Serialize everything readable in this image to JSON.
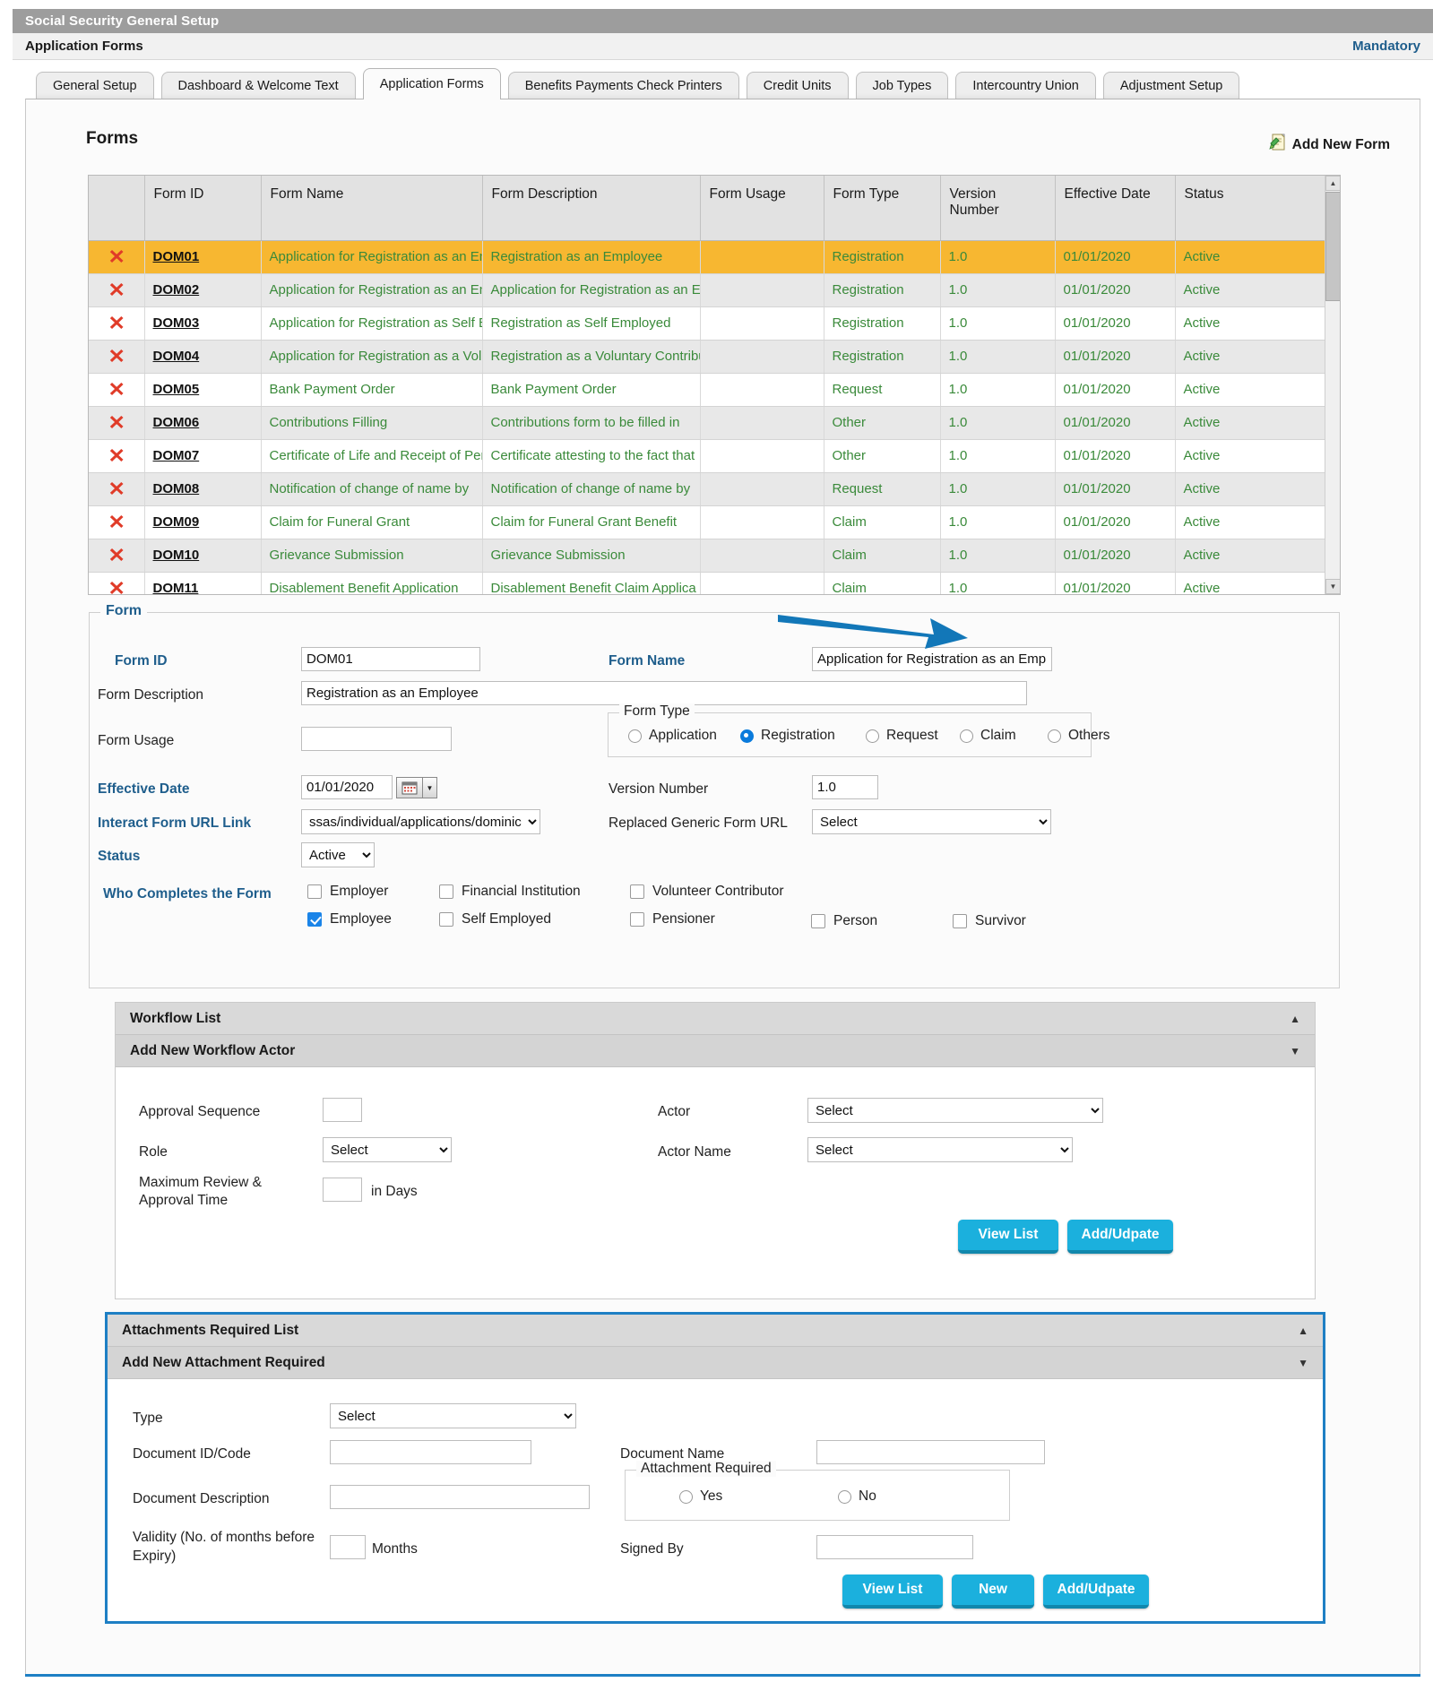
{
  "window": {
    "app_title": "Social Security General Setup",
    "page_title": "Application Forms",
    "mandatory_label": "Mandatory"
  },
  "tabs": [
    {
      "label": "General Setup",
      "active": false
    },
    {
      "label": "Dashboard & Welcome Text",
      "active": false
    },
    {
      "label": "Application Forms",
      "active": true
    },
    {
      "label": "Benefits Payments Check Printers",
      "active": false
    },
    {
      "label": "Credit Units",
      "active": false
    },
    {
      "label": "Job Types",
      "active": false
    },
    {
      "label": "Intercountry Union",
      "active": false
    },
    {
      "label": "Adjustment Setup",
      "active": false
    }
  ],
  "forms_section": {
    "heading": "Forms",
    "add_new_form_label": "Add New Form",
    "columns": [
      "",
      "Form ID",
      "Form Name",
      "Form Description",
      "Form Usage",
      "Form Type",
      "Version Number",
      "Effective Date",
      "Status"
    ],
    "rows": [
      {
        "id": "DOM01",
        "name": "Application for Registration as an Employee",
        "description": "Registration as an Employee",
        "usage": "",
        "type": "Registration",
        "version": "1.0",
        "effective_date": "01/01/2020",
        "status": "Active",
        "selected": true
      },
      {
        "id": "DOM02",
        "name": "Application for Registration as an Employer",
        "description": "Application for Registration as an Employer",
        "usage": "",
        "type": "Registration",
        "version": "1.0",
        "effective_date": "01/01/2020",
        "status": "Active",
        "selected": false
      },
      {
        "id": "DOM03",
        "name": "Application for Registration as Self Employed",
        "description": "Registration as Self Employed",
        "usage": "",
        "type": "Registration",
        "version": "1.0",
        "effective_date": "01/01/2020",
        "status": "Active",
        "selected": false
      },
      {
        "id": "DOM04",
        "name": "Application for Registration as a Voluntary Contributor",
        "description": "Registration as a Voluntary Contributor",
        "usage": "",
        "type": "Registration",
        "version": "1.0",
        "effective_date": "01/01/2020",
        "status": "Active",
        "selected": false
      },
      {
        "id": "DOM05",
        "name": "Bank Payment Order",
        "description": "Bank Payment Order",
        "usage": "",
        "type": "Request",
        "version": "1.0",
        "effective_date": "01/01/2020",
        "status": "Active",
        "selected": false
      },
      {
        "id": "DOM06",
        "name": "Contributions Filling",
        "description": "Contributions form to be filled in",
        "usage": "",
        "type": "Other",
        "version": "1.0",
        "effective_date": "01/01/2020",
        "status": "Active",
        "selected": false
      },
      {
        "id": "DOM07",
        "name": "Certificate of Life and Receipt of Pension",
        "description": "Certificate attesting to the fact that",
        "usage": "",
        "type": "Other",
        "version": "1.0",
        "effective_date": "01/01/2020",
        "status": "Active",
        "selected": false
      },
      {
        "id": "DOM08",
        "name": "Notification of change of name by",
        "description": "Notification of change of name by",
        "usage": "",
        "type": "Request",
        "version": "1.0",
        "effective_date": "01/01/2020",
        "status": "Active",
        "selected": false
      },
      {
        "id": "DOM09",
        "name": "Claim for Funeral Grant",
        "description": "Claim for Funeral Grant Benefit",
        "usage": "",
        "type": "Claim",
        "version": "1.0",
        "effective_date": "01/01/2020",
        "status": "Active",
        "selected": false
      },
      {
        "id": "DOM10",
        "name": "Grievance Submission",
        "description": "Grievance Submission",
        "usage": "",
        "type": "Claim",
        "version": "1.0",
        "effective_date": "01/01/2020",
        "status": "Active",
        "selected": false
      },
      {
        "id": "DOM11",
        "name": "Disablement Benefit Application",
        "description": "Disablement Benefit Claim Applica",
        "usage": "",
        "type": "Claim",
        "version": "1.0",
        "effective_date": "01/01/2020",
        "status": "Active",
        "selected": false
      }
    ]
  },
  "form": {
    "legend": "Form",
    "form_id_label": "Form ID",
    "form_id_value": "DOM01",
    "form_name_label": "Form Name",
    "form_name_value": "Application for Registration as an Employee",
    "form_description_label": "Form Description",
    "form_description_value": "Registration as an Employee",
    "form_usage_label": "Form Usage",
    "form_usage_value": "",
    "form_type_legend": "Form Type",
    "form_type_options": [
      {
        "label": "Application",
        "selected": false
      },
      {
        "label": "Registration",
        "selected": true
      },
      {
        "label": "Request",
        "selected": false
      },
      {
        "label": "Claim",
        "selected": false
      },
      {
        "label": "Others",
        "selected": false
      }
    ],
    "effective_date_label": "Effective Date",
    "effective_date_value": "01/01/2020",
    "version_number_label": "Version Number",
    "version_number_value": "1.0",
    "interact_url_label": "Interact Form URL Link",
    "interact_url_value": "ssas/individual/applications/dominica_",
    "replaced_url_label": "Replaced Generic Form URL",
    "replaced_url_value": "Select",
    "status_label": "Status",
    "status_value": "Active",
    "who_completes_label": "Who Completes the Form",
    "who_completes_options": [
      {
        "label": "Employer",
        "checked": false
      },
      {
        "label": "Financial Institution",
        "checked": false
      },
      {
        "label": "Volunteer Contributor",
        "checked": false
      },
      {
        "label": "Employee",
        "checked": true
      },
      {
        "label": "Self Employed",
        "checked": false
      },
      {
        "label": "Pensioner",
        "checked": false
      },
      {
        "label": "Person",
        "checked": false
      },
      {
        "label": "Survivor",
        "checked": false
      }
    ]
  },
  "workflow": {
    "list_title": "Workflow List",
    "add_title": "Add New Workflow Actor",
    "approval_sequence_label": "Approval Sequence",
    "approval_sequence_value": "",
    "role_label": "Role",
    "role_value": "Select",
    "max_time_label": "Maximum Review & Approval Time",
    "max_time_value": "",
    "in_days_label": "in Days",
    "actor_label": "Actor",
    "actor_value": "Select",
    "actor_name_label": "Actor Name",
    "actor_name_value": "Select",
    "view_list_label": "View List",
    "add_update_label": "Add/Udpate"
  },
  "attachments": {
    "list_title": "Attachments Required List",
    "add_title": "Add New Attachment Required",
    "type_label": "Type",
    "type_value": "Select",
    "doc_id_label": "Document ID/Code",
    "doc_id_value": "",
    "doc_name_label": "Document Name",
    "doc_name_value": "",
    "doc_desc_label": "Document Description",
    "doc_desc_value": "",
    "attachment_required_legend": "Attachment Required",
    "attachment_required_options": [
      {
        "label": "Yes",
        "selected": false
      },
      {
        "label": "No",
        "selected": false
      }
    ],
    "validity_label": "Validity (No. of months before Expiry)",
    "validity_value": "",
    "months_label": "Months",
    "signed_by_label": "Signed By",
    "signed_by_value": "",
    "view_list_label": "View List",
    "new_label": "New",
    "add_update_label": "Add/Udpate"
  },
  "colors": {
    "accent_blue": "#1e7fc4",
    "button_cyan": "#1bb0dd",
    "selected_row": "#f7b731",
    "grid_text_green": "#3a8a3a",
    "label_blue": "#1f5e8c"
  }
}
